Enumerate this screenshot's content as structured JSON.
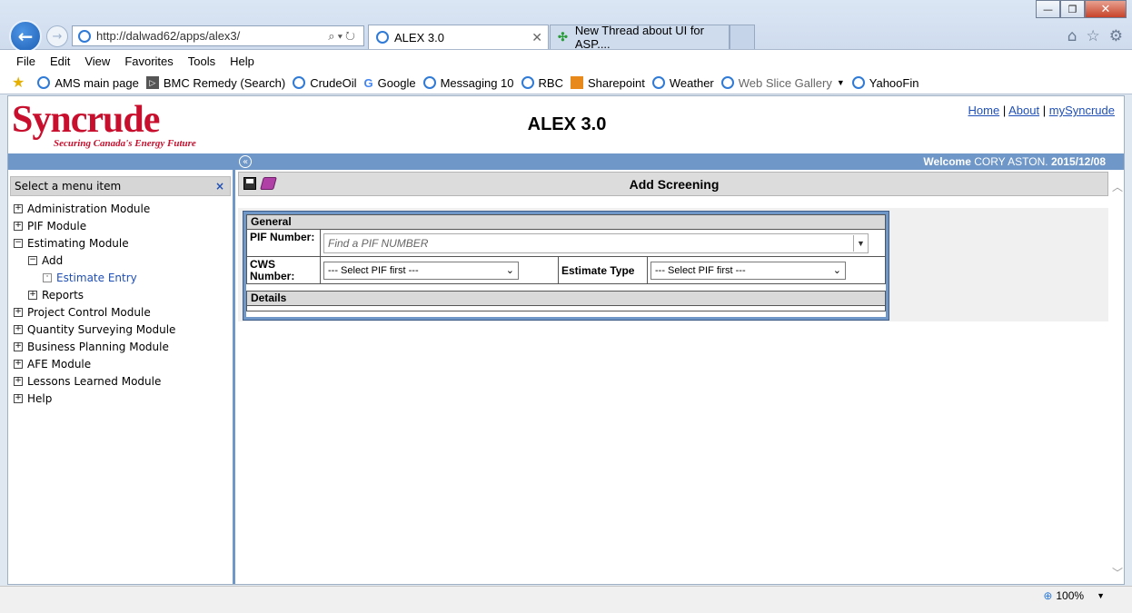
{
  "browser": {
    "address": "http://dalwad62/apps/alex3/",
    "tabs": [
      {
        "title": "ALEX 3.0"
      },
      {
        "title": "New Thread about UI for ASP...."
      }
    ],
    "menu": [
      "File",
      "Edit",
      "View",
      "Favorites",
      "Tools",
      "Help"
    ],
    "favorites": [
      "AMS main page",
      "BMC Remedy (Search)",
      "CrudeOil",
      "Google",
      "Messaging 10",
      "RBC",
      "Sharepoint",
      "Weather",
      "Web Slice Gallery",
      "YahooFin"
    ],
    "zoom": "100%"
  },
  "header": {
    "logo_word": "Syncrude",
    "logo_tagline": "Securing Canada's Energy Future",
    "app_title": "ALEX 3.0",
    "links": {
      "home": "Home",
      "about": "About",
      "mysyncrude": "mySyncrude"
    },
    "link_sep": "|",
    "welcome_prefix": "Welcome",
    "welcome_user": "CORY ASTON.",
    "welcome_date": "2015/12/08"
  },
  "sidebar": {
    "header": "Select a menu item",
    "close": "×",
    "items": [
      {
        "label": "Administration Module",
        "state": "+"
      },
      {
        "label": "PIF Module",
        "state": "+"
      },
      {
        "label": "Estimating Module",
        "state": "−"
      },
      {
        "label": "Add",
        "state": "−"
      },
      {
        "label": "Estimate Entry",
        "state": "·"
      },
      {
        "label": "Reports",
        "state": "+"
      },
      {
        "label": "Project Control Module",
        "state": "+"
      },
      {
        "label": "Quantity Surveying Module",
        "state": "+"
      },
      {
        "label": "Business Planning Module",
        "state": "+"
      },
      {
        "label": "AFE Module",
        "state": "+"
      },
      {
        "label": "Lessons Learned Module",
        "state": "+"
      },
      {
        "label": "Help",
        "state": "+"
      }
    ]
  },
  "main": {
    "title": "Add Screening",
    "general_label": "General",
    "pif_label": "PIF Number:",
    "pif_placeholder": "Find a PIF NUMBER",
    "cws_label": "CWS Number:",
    "cws_value": "--- Select PIF first ---",
    "estimate_type_label": "Estimate Type",
    "estimate_type_value": "--- Select PIF first ---",
    "details_label": "Details"
  },
  "colors": {
    "brand": "#c8102e",
    "bar": "#6f97c8",
    "link": "#1f4fb5"
  }
}
